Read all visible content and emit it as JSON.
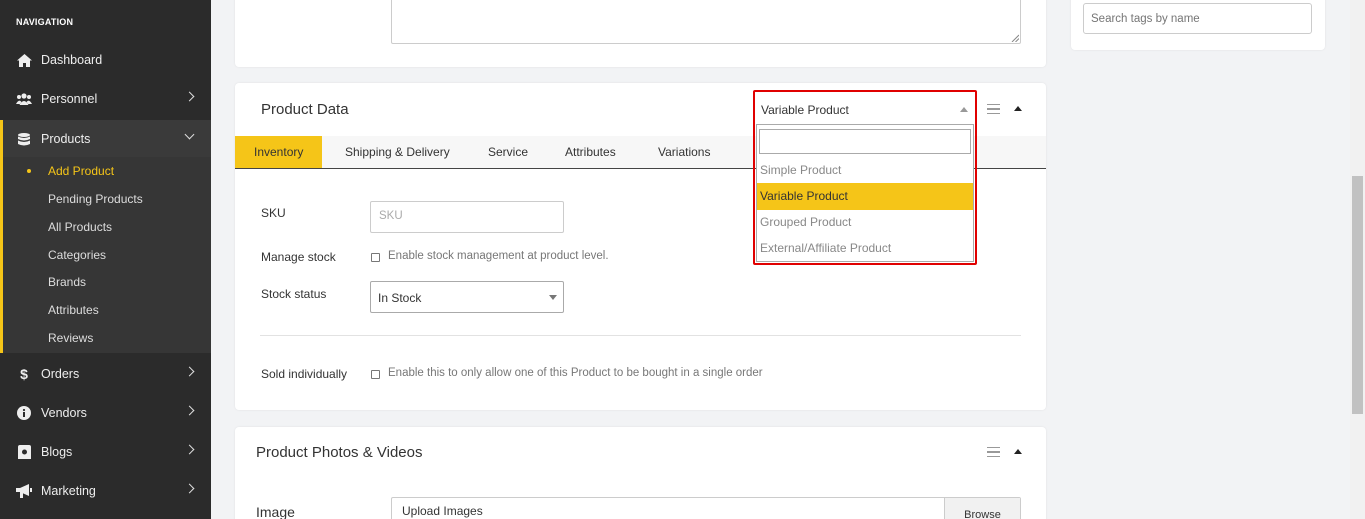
{
  "sidebar": {
    "heading": "NAVIGATION",
    "items": {
      "dashboard": "Dashboard",
      "personnel": "Personnel",
      "products": "Products",
      "orders": "Orders",
      "vendors": "Vendors",
      "blogs": "Blogs",
      "marketing": "Marketing"
    },
    "sub_items": [
      "Add Product",
      "Pending Products",
      "All Products",
      "Categories",
      "Brands",
      "Attributes",
      "Reviews"
    ]
  },
  "tags": {
    "search_placeholder": "Search tags by name"
  },
  "product_data": {
    "title": "Product Data",
    "type_selected": "Variable Product",
    "type_options": [
      "Simple Product",
      "Variable Product",
      "Grouped Product",
      "External/Affiliate Product"
    ],
    "tabs": [
      "Inventory",
      "Shipping & Delivery",
      "Service",
      "Attributes",
      "Variations"
    ],
    "sku_label": "SKU",
    "sku_placeholder": "SKU",
    "manage_stock_label": "Manage stock",
    "manage_stock_text": "Enable stock management at product level.",
    "stock_status_label": "Stock status",
    "stock_status_value": "In Stock",
    "sold_individually_label": "Sold individually",
    "sold_individually_text": "Enable this to only allow one of this Product to be bought in a single order"
  },
  "photos": {
    "title": "Product Photos & Videos",
    "image_label": "Image",
    "upload_text": "Upload Images",
    "browse_label": "Browse"
  },
  "colors": {
    "accent": "#f5c518",
    "highlight": "#e00000",
    "sidebar_bg": "#2b2b2b"
  }
}
